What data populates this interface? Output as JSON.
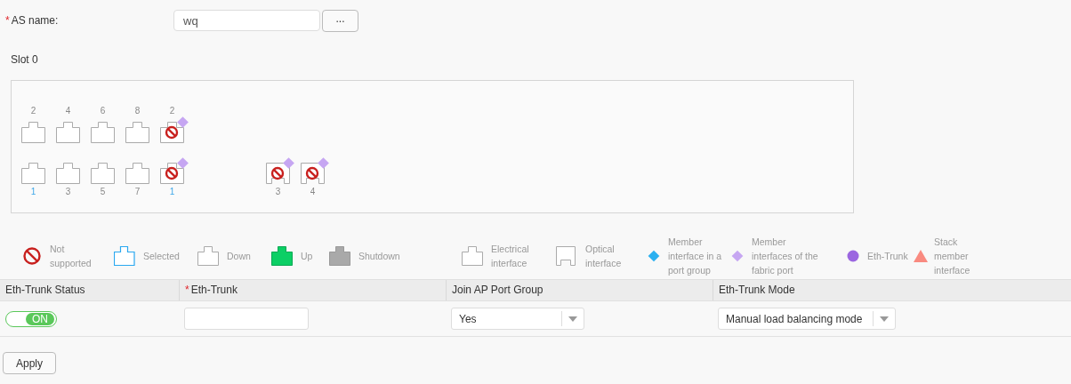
{
  "as_name": {
    "required_mark": "*",
    "label": "AS name:",
    "value": "wq",
    "browse_button": "..."
  },
  "slot": {
    "title": "Slot 0",
    "groups": [
      {
        "columns": [
          {
            "top": {
              "number": "2",
              "kind": "electrical",
              "not_supported": false,
              "fabric_member": false,
              "accent": false
            },
            "bottom": {
              "number": "1",
              "kind": "electrical",
              "not_supported": false,
              "fabric_member": false,
              "accent": true
            }
          },
          {
            "top": {
              "number": "4",
              "kind": "electrical",
              "not_supported": false,
              "fabric_member": false,
              "accent": false
            },
            "bottom": {
              "number": "3",
              "kind": "electrical",
              "not_supported": false,
              "fabric_member": false,
              "accent": false
            }
          },
          {
            "top": {
              "number": "6",
              "kind": "electrical",
              "not_supported": false,
              "fabric_member": false,
              "accent": false
            },
            "bottom": {
              "number": "5",
              "kind": "electrical",
              "not_supported": false,
              "fabric_member": false,
              "accent": false
            }
          },
          {
            "top": {
              "number": "8",
              "kind": "electrical",
              "not_supported": false,
              "fabric_member": false,
              "accent": false
            },
            "bottom": {
              "number": "7",
              "kind": "electrical",
              "not_supported": false,
              "fabric_member": false,
              "accent": false
            }
          },
          {
            "top": {
              "number": "2",
              "kind": "electrical",
              "not_supported": true,
              "fabric_member": true,
              "accent": false
            },
            "bottom": {
              "number": "1",
              "kind": "electrical",
              "not_supported": true,
              "fabric_member": true,
              "accent": true
            }
          }
        ]
      },
      {
        "columns": [
          {
            "bottom": {
              "number": "3",
              "kind": "optical",
              "not_supported": true,
              "fabric_member": true,
              "accent": false
            }
          },
          {
            "bottom": {
              "number": "4",
              "kind": "optical",
              "not_supported": true,
              "fabric_member": true,
              "accent": false
            }
          }
        ]
      }
    ]
  },
  "legend": [
    {
      "kind": "not_supported",
      "label": "Not supported"
    },
    {
      "kind": "selected",
      "label": "Selected"
    },
    {
      "kind": "down",
      "label": "Down"
    },
    {
      "kind": "up",
      "label": "Up"
    },
    {
      "kind": "shutdown",
      "label": "Shutdown"
    },
    {
      "kind": "electrical",
      "label": "Electrical interface"
    },
    {
      "kind": "optical",
      "label": "Optical interface"
    },
    {
      "kind": "port_group_member",
      "label": "Member interface in a port group"
    },
    {
      "kind": "fabric_member",
      "label": "Member interfaces of the fabric port"
    },
    {
      "kind": "eth_trunk",
      "label": "Eth-Trunk"
    },
    {
      "kind": "stack_member",
      "label": "Stack member interface"
    }
  ],
  "table": {
    "columns": [
      {
        "label": "Eth-Trunk Status"
      },
      {
        "required_mark": "*",
        "label": "Eth-Trunk"
      },
      {
        "label": "Join AP Port Group"
      },
      {
        "label": "Eth-Trunk Mode"
      }
    ],
    "row": {
      "status": {
        "on": true,
        "label": "ON"
      },
      "join_ap_port_group": {
        "value": "Yes"
      },
      "mode": {
        "value": "Manual load balancing mode"
      }
    }
  },
  "apply_button": "Apply"
}
